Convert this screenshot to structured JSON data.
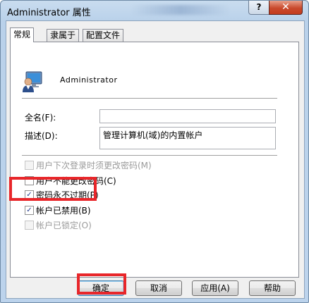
{
  "window": {
    "title": "Administrator 属性",
    "help_label": "?",
    "close_label": "✕"
  },
  "tabs": [
    {
      "label": "常规"
    },
    {
      "label": "隶属于"
    },
    {
      "label": "配置文件"
    }
  ],
  "user": {
    "icon": "user-monitor-icon",
    "name": "Administrator"
  },
  "fields": {
    "full_name_label": "全名(F):",
    "full_name_value": "",
    "description_label": "描述(D):",
    "description_value": "管理计算机(域)的内置帐户"
  },
  "checks": [
    {
      "label": "用户下次登录时须更改密码(M)",
      "checked": false,
      "disabled": true
    },
    {
      "label": "用户不能更改密码(C)",
      "checked": false,
      "disabled": false
    },
    {
      "label": "密码永不过期(P)",
      "checked": true,
      "disabled": false
    },
    {
      "label": "帐户已禁用(B)",
      "checked": true,
      "disabled": false
    },
    {
      "label": "帐户已锁定(O)",
      "checked": false,
      "disabled": true
    }
  ],
  "buttons": {
    "ok": "确定",
    "cancel": "取消",
    "apply": "应用(A)",
    "help": "帮助"
  },
  "colors": {
    "highlight": "#e8262a",
    "title_bar": "#bcd3ec"
  }
}
